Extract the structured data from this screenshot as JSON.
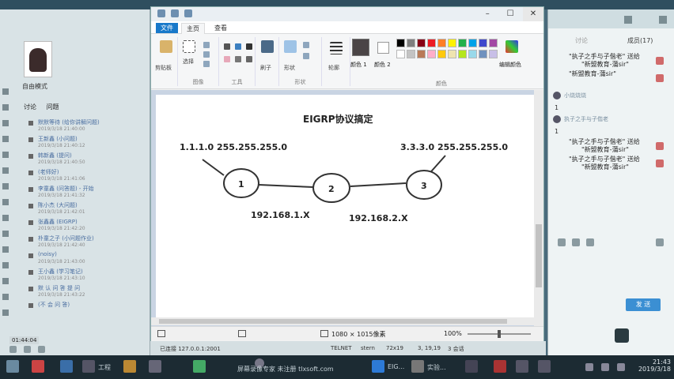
{
  "window": {
    "title": "",
    "tabs": {
      "file": "文件",
      "home": "主页",
      "view": "查看"
    }
  },
  "ribbon": {
    "clipboard_label": "剪贴板",
    "select_label": "选择",
    "brushes_label": "刷子",
    "shapes_label": "形状",
    "outline_label": "轮廓",
    "color1_label": "颜色 1",
    "color2_label": "颜色 2",
    "edit_colors_label": "编辑颜色",
    "group_image": "图像",
    "group_tools": "工具",
    "group_shapes": "形状",
    "group_colors": "颜色",
    "colors": {
      "row1": [
        "#000000",
        "#7f7f7f",
        "#880015",
        "#ed1c24",
        "#ff7f27",
        "#fff200",
        "#22b14c",
        "#00a2e8",
        "#3f48cc",
        "#a349a4"
      ],
      "row2": [
        "#ffffff",
        "#c3c3c3",
        "#b97a57",
        "#ffaec9",
        "#ffc90e",
        "#efe4b0",
        "#b5e61d",
        "#99d9ea",
        "#7092be",
        "#c8bfe7"
      ]
    }
  },
  "canvas": {
    "title": "EIGRP协议搞定",
    "left_network": "1.1.1.0 255.255.255.0",
    "right_network": "3.3.3.0 255.255.255.0",
    "node1": "1",
    "node2": "2",
    "node3": "3",
    "link1": "192.168.1.X",
    "link2": "192.168.2.X"
  },
  "statusbar": {
    "dimensions": "1080 × 1015像素",
    "zoom": "100%"
  },
  "ide_strip": {
    "addr": "已连接 127.0.0.1:2001",
    "telnet": "TELNET",
    "stern": "stern",
    "size": "72x19",
    "pos": "3, 19,19",
    "sessions": "3 会话"
  },
  "left_panel": {
    "mode": "自由模式",
    "tab_discuss": "讨论",
    "tab_question": "问题",
    "status": "01:44:04",
    "items": [
      {
        "text": "默默等待 (给你讲解问题)",
        "sub": "2019/3/18 21:40:00"
      },
      {
        "text": "王新鑫 (小问题)",
        "sub": "2019/3/18 21:40:12"
      },
      {
        "text": "韩新鑫 (提问)",
        "sub": "2019/3/18 21:40:50"
      },
      {
        "text": "(老师好)",
        "sub": "2019/3/18 21:41:06"
      },
      {
        "text": "李童鑫 (问答题) - 开始",
        "sub": "2019/3/18 21:41:32"
      },
      {
        "text": "陈小杰 (大问题)",
        "sub": "2019/3/18 21:42:01"
      },
      {
        "text": "张鑫鑫 (EIGRP)",
        "sub": "2019/3/18 21:42:20"
      },
      {
        "text": "朴童之子 (小问题作业)",
        "sub": "2019/3/18 21:42:40"
      },
      {
        "text": "(noisy)",
        "sub": "2019/3/18 21:43:00"
      },
      {
        "text": "王小鑫 (学习笔记)",
        "sub": "2019/3/18 21:43:10"
      },
      {
        "text": "默 认 问 答 提 问",
        "sub": "2019/3/18 21:43:22"
      },
      {
        "text": "(不 会 问 答)",
        "sub": ""
      }
    ]
  },
  "right_panel": {
    "tab_chat": "讨论",
    "tab_members": "成员(17)",
    "gifts": [
      {
        "from": "\"执子之手与子偕老\" 送给",
        "to": "\"新盟教育-蒲sir\""
      },
      {
        "from": "\"新盟教育-蒲sir\"",
        "to": ""
      }
    ],
    "users": [
      {
        "name": "小烧烧烧",
        "msg": "1"
      },
      {
        "name": "执子之手与子偕老",
        "msg": "1"
      }
    ],
    "gifts2": [
      {
        "from": "\"执子之手与子偕老\" 送给",
        "to": "\"新盟教育-蒲sir\""
      },
      {
        "from": "\"执子之手与子偕老\" 送给",
        "to": "\"新盟教育-蒲sir\""
      }
    ],
    "send": "发 送"
  },
  "taskbar": {
    "time": "21:43",
    "date": "2019/3/18",
    "watermark": "屏幕录像专家 未注册 tlxsoft.com",
    "apps": [
      "工程",
      "EIG...",
      "实验..."
    ]
  }
}
